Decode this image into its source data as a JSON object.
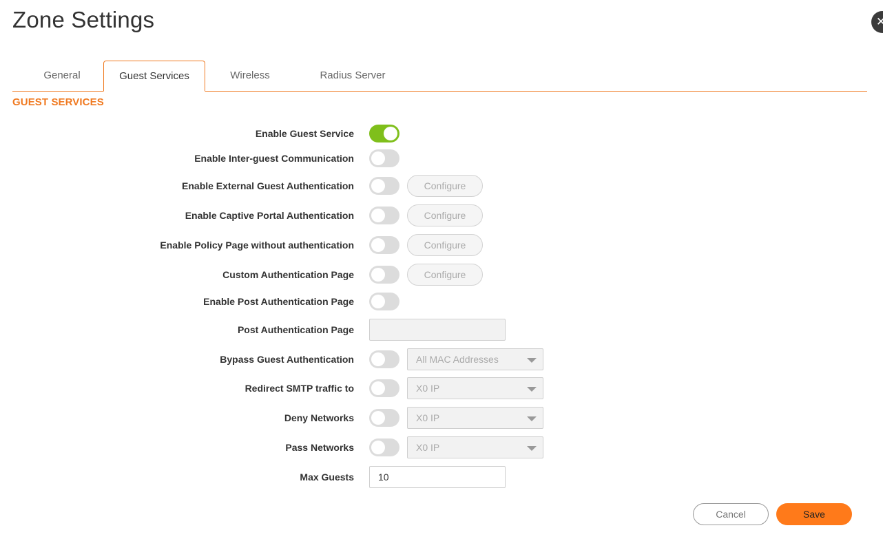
{
  "title": "Zone Settings",
  "tabs": [
    {
      "label": "General"
    },
    {
      "label": "Guest Services"
    },
    {
      "label": "Wireless"
    },
    {
      "label": "Radius Server"
    }
  ],
  "active_tab": "Guest Services",
  "section_title": "GUEST SERVICES",
  "settings": {
    "enable_guest_service": {
      "label": "Enable Guest Service",
      "enabled": true
    },
    "inter_guest": {
      "label": "Enable Inter-guest Communication",
      "enabled": false
    },
    "external_auth": {
      "label": "Enable External Guest Authentication",
      "enabled": false,
      "button": "Configure"
    },
    "captive_portal": {
      "label": "Enable Captive Portal Authentication",
      "enabled": false,
      "button": "Configure"
    },
    "policy_page": {
      "label": "Enable Policy Page without authentication",
      "enabled": false,
      "button": "Configure"
    },
    "custom_auth_page": {
      "label": "Custom Authentication Page",
      "enabled": false,
      "button": "Configure"
    },
    "post_auth_enable": {
      "label": "Enable Post Authentication Page",
      "enabled": false
    },
    "post_auth_page": {
      "label": "Post Authentication Page",
      "value": ""
    },
    "bypass_guest_auth": {
      "label": "Bypass Guest Authentication",
      "enabled": false,
      "selected": "All MAC Addresses"
    },
    "redirect_smtp": {
      "label": "Redirect SMTP traffic to",
      "enabled": false,
      "selected": "X0 IP"
    },
    "deny_networks": {
      "label": "Deny Networks",
      "enabled": false,
      "selected": "X0 IP"
    },
    "pass_networks": {
      "label": "Pass Networks",
      "enabled": false,
      "selected": "X0 IP"
    },
    "max_guests": {
      "label": "Max Guests",
      "value": "10"
    }
  },
  "buttons": {
    "cancel": "Cancel",
    "save": "Save"
  },
  "colors": {
    "accent": "#f07a21",
    "toggle_on": "#7fbf1b",
    "save": "#ff7a1a"
  },
  "icons": {
    "close": "close-icon",
    "caret": "chevron-down-icon"
  }
}
